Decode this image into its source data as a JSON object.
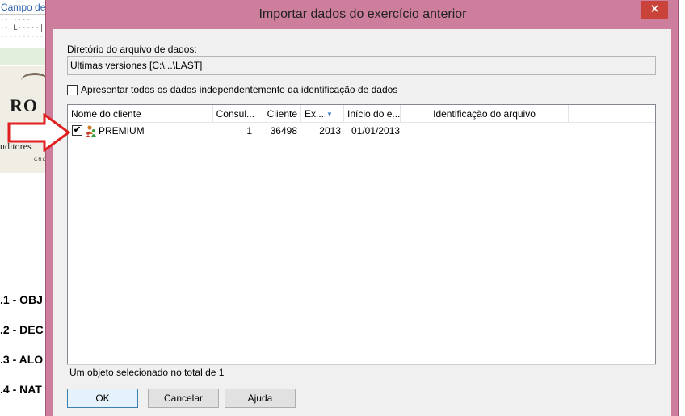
{
  "background_doc": {
    "tab_label": "Campo de",
    "ruler_text": "·······\n···L·····|··\n----------",
    "logo_text": "RO",
    "logo_subtitle": "uditores",
    "logo_small": "CRO",
    "sections": [
      ".1 - OBJ",
      ".2 - DEC",
      ".3 - ALO",
      ".4 - NAT"
    ]
  },
  "dialog": {
    "title": "Importar dados do exercício anterior",
    "close_glyph": "✕",
    "directory_label": "Diretório do arquivo de dados:",
    "directory_value": "Ultimas versiones [C:\\...\\LAST]",
    "option_label": "Apresentar todos os dados independentemente da identificação de dados",
    "option_checked": false,
    "columns": [
      "Nome do cliente",
      "Consul...",
      "Cliente",
      "Ex...",
      "Início do e...",
      "Identificação do arquivo"
    ],
    "sort_glyph": "▼",
    "rows": [
      {
        "checked": true,
        "check_glyph": "✔",
        "icon": "users-icon",
        "name": "PREMIUM",
        "consul": "1",
        "cliente": "36498",
        "exercicio": "2013",
        "inicio": "01/01/2013",
        "identificacao": ""
      }
    ],
    "status_text": "Um objeto selecionado no total de 1",
    "buttons": {
      "ok": "OK",
      "cancel": "Cancelar",
      "help": "Ajuda"
    }
  },
  "colors": {
    "dialog_frame": "#cc7e9c",
    "close_button": "#c9433a",
    "annotation_arrow": "#e02020"
  }
}
